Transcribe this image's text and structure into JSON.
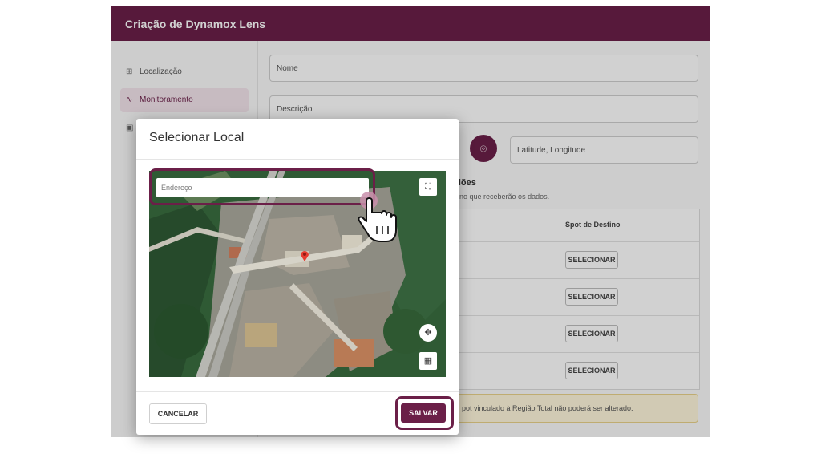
{
  "app": {
    "title": "Criação de Dynamox Lens"
  },
  "sidebar": {
    "items": [
      {
        "label": "Localização",
        "icon": "hierarchy-icon"
      },
      {
        "label": "Monitoramento",
        "icon": "pulse-icon",
        "active": true
      },
      {
        "label": "",
        "icon": "box-icon"
      }
    ]
  },
  "form": {
    "name_placeholder": "Nome",
    "description_placeholder": "Descrição",
    "coords_placeholder": "Latitude, Longitude",
    "regions_title": "egiões",
    "regions_desc": "estino que receberão os dados.",
    "spot_column": "Spot de Destino",
    "select_label": "SELECIONAR",
    "rows": 4,
    "warning": "pot vinculado à Região Total não poderá ser alterado."
  },
  "modal": {
    "title": "Selecionar Local",
    "address_placeholder": "Endereço",
    "cancel_label": "CANCELAR",
    "save_label": "SALVAR"
  },
  "colors": {
    "brand": "#6b1f48",
    "brand_light": "#f3e4ec",
    "warning_bg": "#fff7dc"
  }
}
